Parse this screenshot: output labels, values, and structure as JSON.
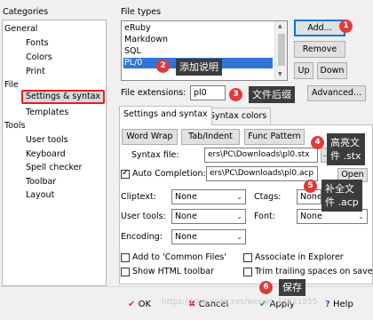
{
  "categories": {
    "title": "Categories",
    "items": [
      {
        "label": "General",
        "level": 0
      },
      {
        "label": "Fonts",
        "level": 1
      },
      {
        "label": "Colors",
        "level": 1
      },
      {
        "label": "Print",
        "level": 1
      },
      {
        "label": "File",
        "level": 0
      },
      {
        "label": "Settings & syntax",
        "level": 1,
        "selected": true
      },
      {
        "label": "Templates",
        "level": 1
      },
      {
        "label": "Tools",
        "level": 0
      },
      {
        "label": "User tools",
        "level": 1
      },
      {
        "label": "Keyboard",
        "level": 1
      },
      {
        "label": "Spell checker",
        "level": 1
      },
      {
        "label": "Toolbar",
        "level": 1
      },
      {
        "label": "Layout",
        "level": 1
      }
    ]
  },
  "file_types": {
    "title": "File types",
    "items": [
      "eRuby",
      "Markdown",
      "SQL",
      "PL/0"
    ],
    "selected": "PL/0",
    "buttons": {
      "add": "Add...",
      "remove": "Remove",
      "up": "Up",
      "down": "Down"
    }
  },
  "extensions": {
    "label": "File extensions:",
    "value": "pl0",
    "advanced": "Advanced..."
  },
  "tabs": {
    "settings": "Settings and syntax",
    "colors": "Syntax colors"
  },
  "toggles": {
    "word_wrap": "Word Wrap",
    "tab_indent": "Tab/Indent",
    "func_pattern": "Func Pattern"
  },
  "syntax_file": {
    "label": "Syntax file:",
    "value": "ers\\PC\\Downloads\\pl0.stx",
    "browse": "..."
  },
  "auto_completion": {
    "label": "Auto Completion:",
    "checked": true,
    "value": "ers\\PC\\Downloads\\pl0.acp",
    "open": "Open"
  },
  "selects": {
    "cliptext": {
      "label": "Cliptext:",
      "value": "None"
    },
    "ctags": {
      "label": "Ctags:",
      "value": "None"
    },
    "user_tools": {
      "label": "User tools:",
      "value": "None"
    },
    "font": {
      "label": "Font:",
      "value": "None"
    },
    "encoding": {
      "label": "Encoding:",
      "value": "None"
    }
  },
  "checkboxes": {
    "common_files": "Add to 'Common Files'",
    "associate": "Associate in Explorer",
    "html_toolbar": "Show HTML toolbar",
    "trim": "Trim trailing spaces on save"
  },
  "annotations": {
    "a1": {
      "num": "1"
    },
    "a2": {
      "num": "2",
      "text": "添加说明"
    },
    "a3": {
      "num": "3",
      "text": "文件后缀"
    },
    "a4": {
      "num": "4",
      "line1": "高亮文",
      "line2": "件 .stx"
    },
    "a5": {
      "num": "5",
      "line1": "补全文",
      "line2": "件 .acp"
    },
    "a6": {
      "num": "6",
      "text": "保存"
    }
  },
  "footer": {
    "ok": "OK",
    "cancel": "Cancel",
    "apply": "Apply",
    "help": "Help",
    "watermark": "https://blog.csdn.net/weixin_43821855"
  },
  "colors": {
    "accent": "#3075d7",
    "annotation": "#e03a3a",
    "tooltip": "#3c3c3c"
  }
}
